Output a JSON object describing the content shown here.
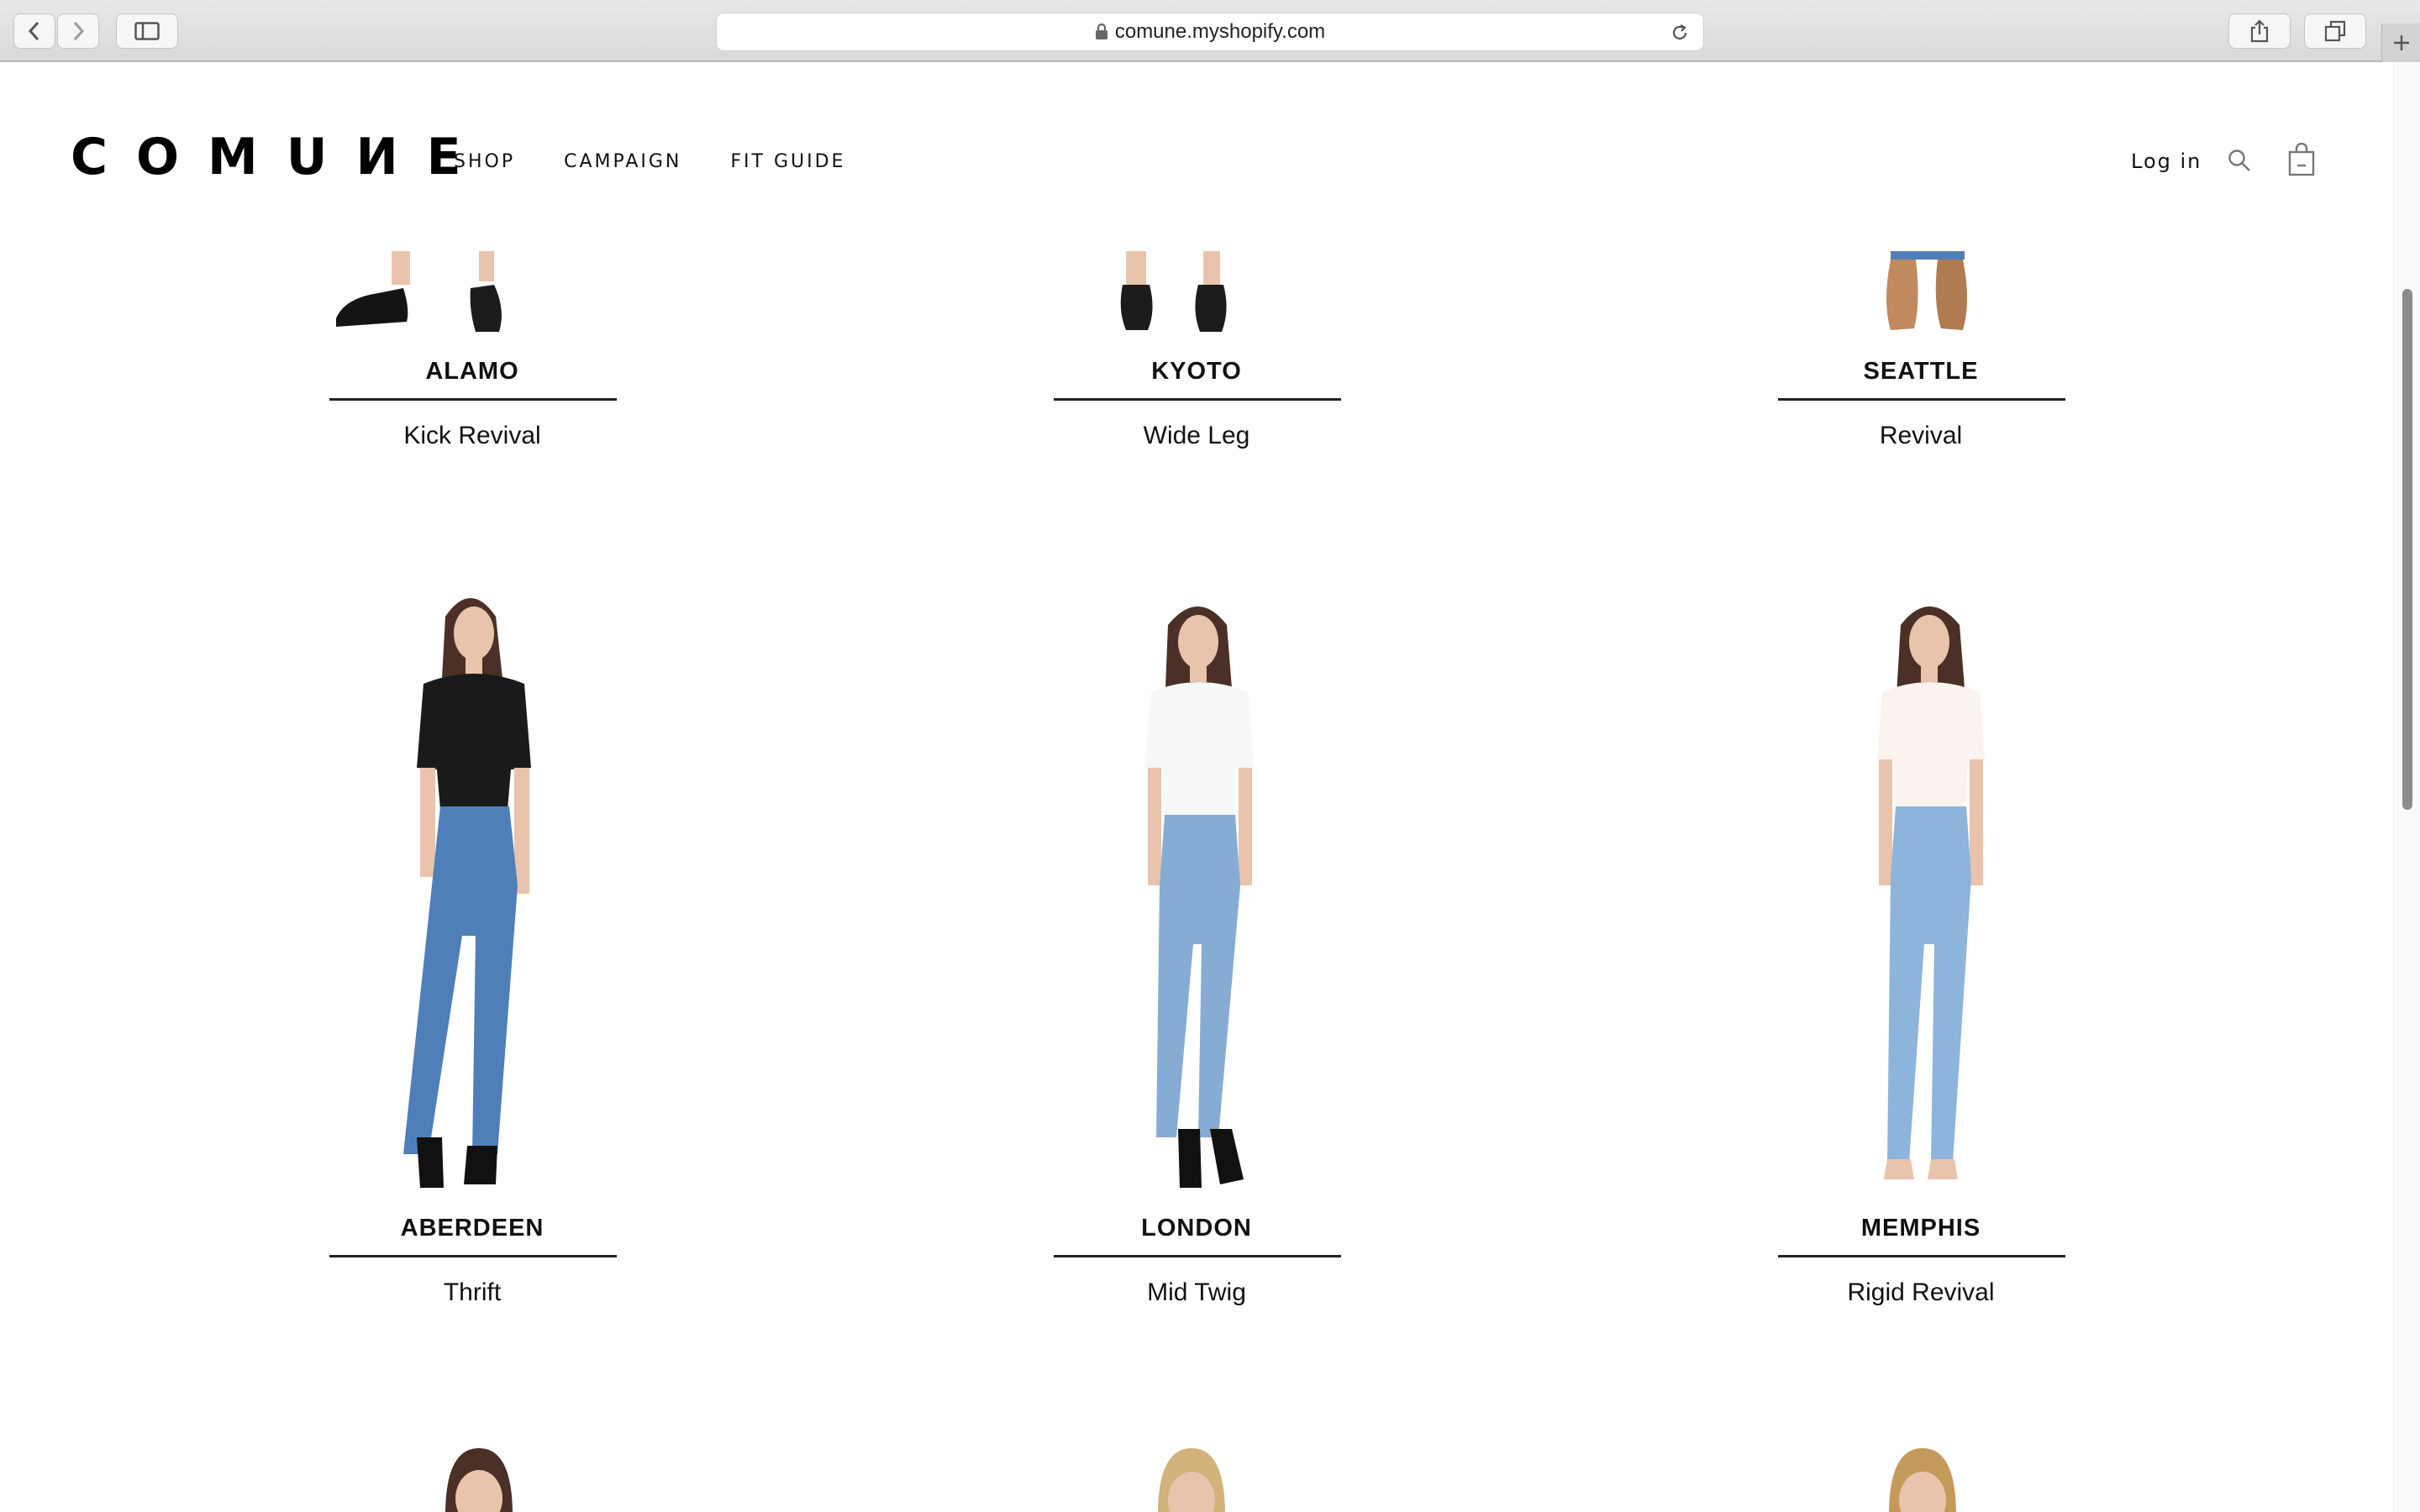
{
  "browser": {
    "url": "comune.myshopify.com",
    "back_icon": "chevron-left-icon",
    "forward_icon": "chevron-right-icon",
    "sidebar_icon": "sidebar-icon",
    "share_icon": "share-icon",
    "tabs_icon": "tabs-icon",
    "new_tab_icon": "plus-icon",
    "reload_icon": "reload-icon",
    "lock_icon": "lock-icon"
  },
  "header": {
    "logo": "COMUИE",
    "nav": [
      "SHOP",
      "CAMPAIGN",
      "FIT GUIDE"
    ],
    "login": "Log in",
    "search_icon": "search-icon",
    "cart_icon": "shopping-bag-icon"
  },
  "products": {
    "row1": [
      {
        "name": "ALAMO",
        "desc": "Kick Revival"
      },
      {
        "name": "KYOTO",
        "desc": "Wide Leg"
      },
      {
        "name": "SEATTLE",
        "desc": "Revival"
      }
    ],
    "row2": [
      {
        "name": "ABERDEEN",
        "desc": "Thrift",
        "top_color": "#1a1a1a",
        "jean_color": "#4f7fb8"
      },
      {
        "name": "LONDON",
        "desc": "Mid Twig",
        "top_color": "#f7f7f7",
        "jean_color": "#86acd4"
      },
      {
        "name": "MEMPHIS",
        "desc": "Rigid Revival",
        "top_color": "#fbf3ef",
        "jean_color": "#8db4da"
      }
    ]
  },
  "colors": {
    "text": "#111111",
    "underline": "#222222",
    "skin": "#e9c3ab",
    "hair_dark": "#4a3026",
    "hair_blonde": "#d3b27c"
  }
}
